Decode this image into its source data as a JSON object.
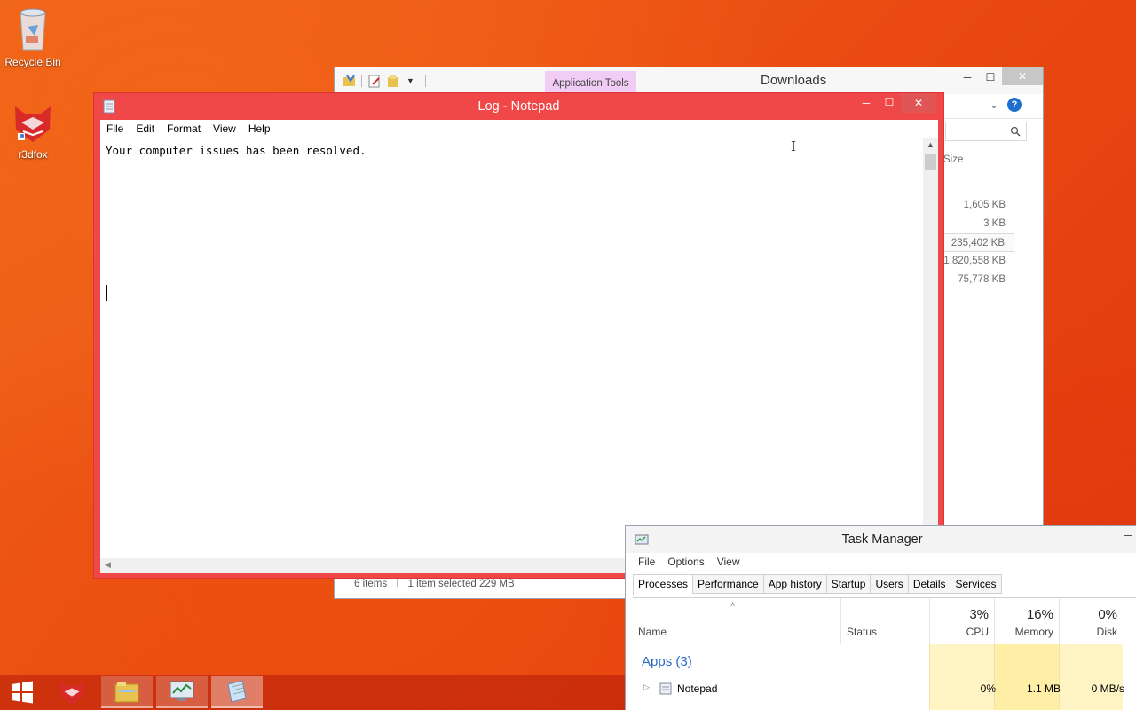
{
  "desktop": {
    "icons": [
      {
        "label": "Recycle Bin"
      },
      {
        "label": "r3dfox"
      }
    ]
  },
  "explorer": {
    "title": "Downloads",
    "application_tools": "Application Tools",
    "size_header": "Size",
    "sizes": [
      "1,605 KB",
      "3 KB",
      "235,402 KB",
      "1,820,558 KB",
      "75,778 KB"
    ],
    "status_items": "6 items",
    "status_selected": "1 item selected  229 MB",
    "help": "?"
  },
  "notepad": {
    "title": "Log - Notepad",
    "menu": [
      "File",
      "Edit",
      "Format",
      "View",
      "Help"
    ],
    "content": "Your computer issues has been resolved."
  },
  "taskmgr": {
    "title": "Task Manager",
    "menu": [
      "File",
      "Options",
      "View"
    ],
    "tabs": [
      "Processes",
      "Performance",
      "App history",
      "Startup",
      "Users",
      "Details",
      "Services"
    ],
    "columns": {
      "name": "Name",
      "status": "Status",
      "cpu_pct": "3%",
      "cpu": "CPU",
      "memory_pct": "16%",
      "memory": "Memory",
      "disk_pct": "0%",
      "disk": "Disk"
    },
    "apps_group": "Apps (3)",
    "rows": [
      {
        "name": "Notepad",
        "cpu": "0%",
        "memory": "1.1 MB",
        "disk": "0 MB/s"
      }
    ]
  },
  "colors": {
    "notepad_frame": "#f04848",
    "apps_group": "#2a6bc7",
    "app_tools_tab": "#f1ccf4"
  }
}
